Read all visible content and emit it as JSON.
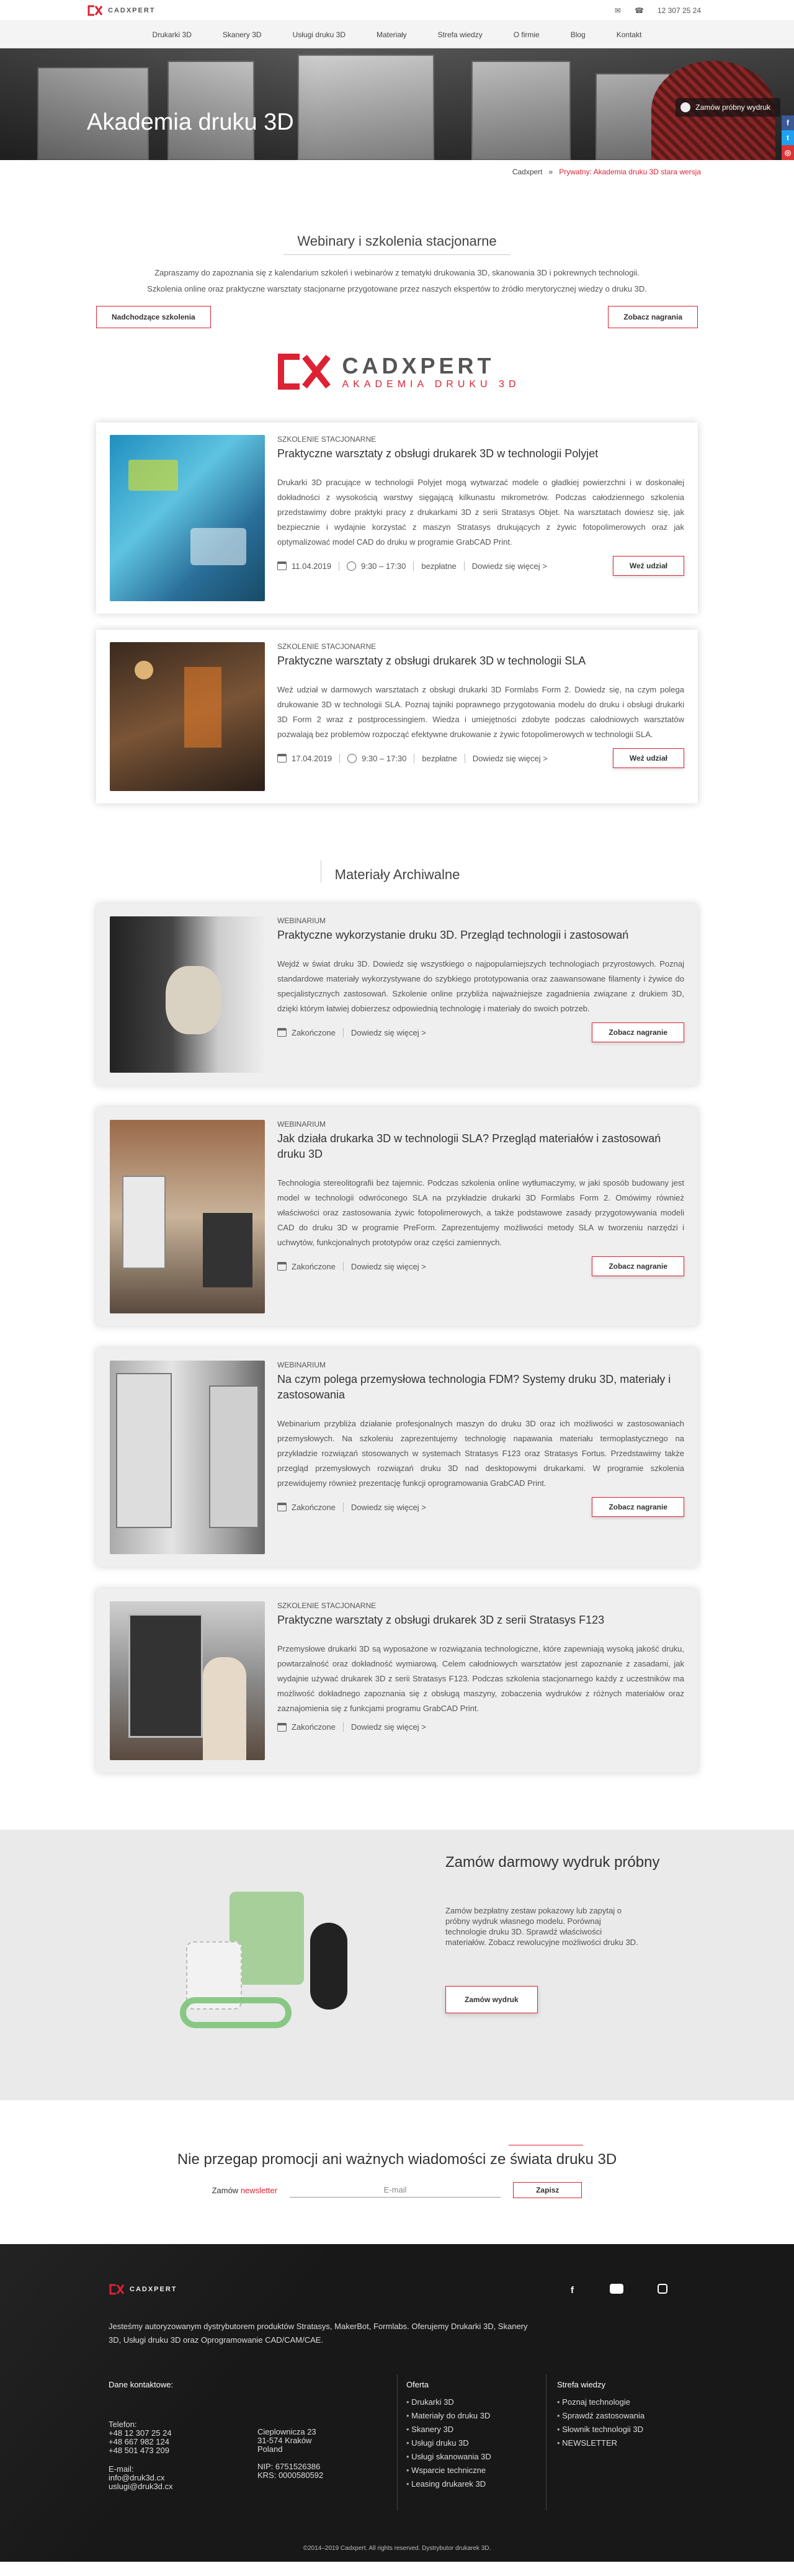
{
  "header": {
    "logo_text": "CADXPERT",
    "phone": "12 307 25 24",
    "colors": {
      "accent": "#dd2233"
    }
  },
  "nav": [
    "Drukarki 3D",
    "Skanery 3D",
    "Usługi druku 3D",
    "Materiały",
    "Strefa wiedzy",
    "O firmie",
    "Blog",
    "Kontakt"
  ],
  "hero": {
    "title": "Akademia druku 3D",
    "order_label": "Zamów próbny wydruk"
  },
  "breadcrumb": {
    "home": "Cadxpert",
    "sep": "»",
    "current": "Prywatny: Akademia druku 3D stara wersja"
  },
  "webinars": {
    "title": "Webinary i szkolenia stacjonarne",
    "intro_1": "Zapraszamy do zapoznania się z kalendarium szkoleń i webinarów z tematyki drukowania 3D, skanowania 3D i pokrewnych technologii.",
    "intro_2": "Szkolenia online oraz praktyczne warsztaty stacjonarne przygotowane przez naszych ekspertów to źródło merytorycznej wiedzy o druku 3D.",
    "upcoming_btn": "Nadchodzące szkolenia",
    "recordings_btn": "Zobacz nagrania"
  },
  "brand": {
    "name": "CADXPERT",
    "sub": "AKADEMIA DRUKU 3D"
  },
  "upcoming": [
    {
      "type": "SZKOLENIE STACJONARNE",
      "title": "Praktyczne warsztaty z obsługi drukarek 3D w technologii Polyjet",
      "desc": "Drukarki 3D pracujące w technologii Polyjet mogą wytwarzać modele o gładkiej powierzchni i w doskonałej dokładności z wysokością warstwy sięgającą kilkunastu mikrometrów. Podczas całodziennego szkolenia przedstawimy dobre praktyki pracy z drukarkami 3D z serii Stratasys Objet. Na warsztatach dowiesz się, jak bezpiecznie i wydajnie korzystać z maszyn Stratasys drukujących z żywic fotopolimerowych oraz jak optymalizować model CAD do druku w programie GrabCAD Print.",
      "date": "11.04.2019",
      "time": "9:30 – 17:30",
      "price": "bezpłatne",
      "more": "Dowiedz się więcej >",
      "btn": "Weź udział"
    },
    {
      "type": "SZKOLENIE STACJONARNE",
      "title": "Praktyczne warsztaty z obsługi drukarek 3D w technologii SLA",
      "desc": "Weź udział w darmowych warsztatach z obsługi drukarki 3D Formlabs Form 2. Dowiedz się, na czym polega drukowanie 3D w technologii SLA. Poznaj tajniki poprawnego przygotowania modelu do druku i obsługi drukarki 3D Form 2 wraz z postprocessingiem. Wiedza i umiejętności zdobyte podczas całodniowych warsztatów pozwalają bez problemów rozpocząć efektywne drukowanie z żywic fotopolimerowych w technologii SLA.",
      "date": "17.04.2019",
      "time": "9:30 – 17:30",
      "price": "bezpłatne",
      "more": "Dowiedz się więcej >",
      "btn": "Weź udział"
    }
  ],
  "archive_title": "Materiały Archiwalne",
  "archive": [
    {
      "type": "WEBINARIUM",
      "title": "Praktyczne wykorzystanie druku 3D. Przegląd technologii i zastosowań",
      "desc": "Wejdź w świat druku 3D. Dowiedz się wszystkiego o najpopularniejszych technologiach przyrostowych. Poznaj standardowe materiały wykorzystywane do szybkiego prototypowania oraz zaawansowane filamenty i żywice do specjalistycznych zastosowań. Szkolenie online przybliża najważniejsze zagadnienia związane z drukiem 3D, dzięki którym łatwiej dobierzesz odpowiednią technologię i materiały do swoich potrzeb.",
      "status": "Zakończone",
      "more": "Dowiedz się więcej >",
      "btn": "Zobacz nagranie"
    },
    {
      "type": "WEBINARIUM",
      "title": "Jak działa drukarka 3D w technologii SLA? Przegląd materiałów i zastosowań druku 3D",
      "desc": "Technologia stereolitografii bez tajemnic. Podczas szkolenia online wytłumaczymy, w jaki sposób budowany jest model w technologii odwróconego SLA na przykładzie drukarki 3D Formlabs Form 2. Omówimy również właściwości oraz zastosowania żywic fotopolimerowych, a także podstawowe zasady przygotowywania modeli CAD do druku 3D w programie PreForm. Zaprezentujemy możliwości metody SLA w tworzeniu narzędzi i uchwytów, funkcjonalnych prototypów oraz części zamiennych.",
      "status": "Zakończone",
      "more": "Dowiedz się więcej >",
      "btn": "Zobacz nagranie"
    },
    {
      "type": "WEBINARIUM",
      "title": "Na czym polega przemysłowa technologia FDM? Systemy druku 3D, materiały i zastosowania",
      "desc": "Webinarium przybliża działanie profesjonalnych maszyn do druku 3D oraz ich możliwości w zastosowaniach przemysłowych. Na szkoleniu zaprezentujemy technologię napawania materiału termoplastycznego na przykładzie rozwiązań stosowanych w systemach Stratasys F123 oraz Stratasys Fortus. Przedstawimy także przegląd przemysłowych rozwiązań druku 3D nad desktopowymi drukarkami. W programie szkolenia przewidujemy również prezentację funkcji oprogramowania GrabCAD Print.",
      "status": "Zakończone",
      "more": "Dowiedz się więcej >",
      "btn": "Zobacz nagranie"
    },
    {
      "type": "SZKOLENIE STACJONARNE",
      "title": "Praktyczne warsztaty z obsługi drukarek 3D z serii Stratasys F123",
      "desc": "Przemysłowe drukarki 3D są wyposażone w rozwiązania technologiczne, które zapewniają wysoką jakość druku, powtarzalność oraz dokładność wymiarową. Celem całodniowych warsztatów jest zapoznanie z zasadami, jak wydajnie używać drukarek 3D z serii Stratasys F123. Podczas szkolenia stacjonarnego każdy z uczestników ma możliwość dokładnego zapoznania się z obsługą maszyny, zobaczenia wydruków z różnych materiałów oraz zaznajomienia się z funkcjami programu GrabCAD Print.",
      "status": "Zakończone",
      "more": "Dowiedz się więcej >",
      "btn": ""
    }
  ],
  "promo": {
    "title": "Zamów darmowy wydruk próbny",
    "text": "Zamów bezpłatny zestaw pokazowy lub zapytaj o próbny wydruk własnego modelu. Porównaj technologie druku 3D. Sprawdź właściwości materiałów. Zobacz rewolucyjne możliwości druku 3D.",
    "btn": "Zamów wydruk"
  },
  "newsletter": {
    "title": "Nie przegap promocji ani ważnych wiadomości ze świata druku 3D",
    "label": "Zamów",
    "label_link": "newsletter",
    "placeholder": "E-mail",
    "btn": "Zapisz"
  },
  "footer": {
    "desc": "Jesteśmy autoryzowanym dystrybutorem produktów Stratasys, MakerBot, Formlabs. Oferujemy Drukarki 3D, Skanery 3D, Usługi druku 3D oraz Oprogramowanie CAD/CAM/CAE.",
    "contact_head": "Dane kontaktowe:",
    "phone_label": "Telefon:",
    "phones": [
      "+48 12 307 25 24",
      "+48 667 982 124",
      "+48 501 473 209"
    ],
    "email_label": "E-mail:",
    "emails": [
      "info@druk3d.cx",
      "uslugi@druk3d.cx"
    ],
    "address": [
      "Cieplownicza 23",
      "31-574 Kraków",
      "Poland"
    ],
    "ids": [
      "NIP: 6751526386",
      "KRS: 0000580592"
    ],
    "offer_head": "Oferta",
    "offer": [
      "Drukarki 3D",
      "Materiały do druku 3D",
      "Skanery 3D",
      "Usługi druku 3D",
      "Usługi skanowania 3D",
      "Wsparcie techniczne",
      "Leasing drukarek 3D"
    ],
    "know_head": "Strefa wiedzy",
    "know": [
      "Poznaj technologie",
      "Sprawdź zastosowania",
      "Słownik technologii 3D",
      "NEWSLETTER"
    ],
    "copyright": "©2014–2019 Cadxpert. All rights reserved. Dystrybutor drukarek 3D."
  }
}
